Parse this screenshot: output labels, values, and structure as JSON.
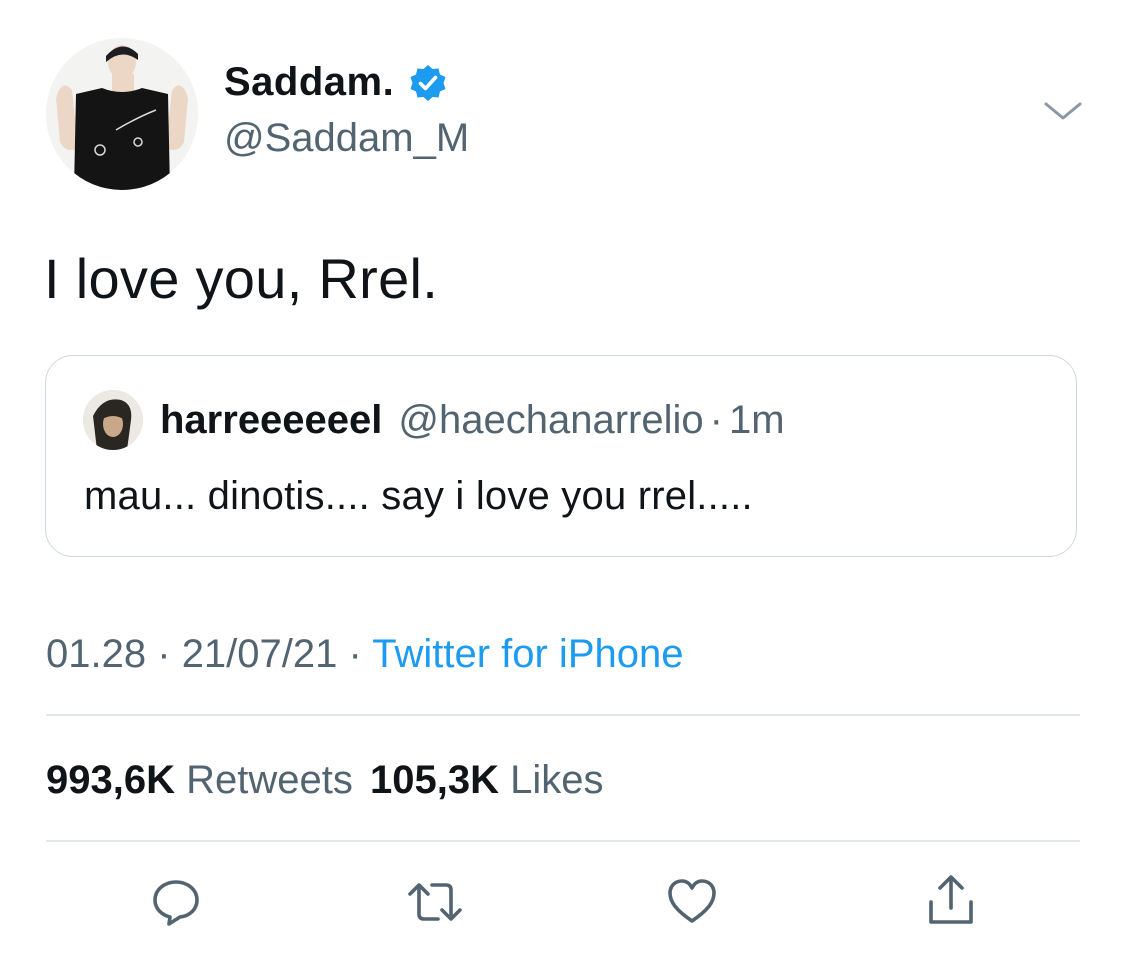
{
  "tweet": {
    "author": {
      "display_name": "Saddam.",
      "handle": "@Saddam_M",
      "verified": true
    },
    "text": "I love you, Rrel.",
    "quoted": {
      "display_name": "harreeeeeel",
      "handle": "@haechanarrelio",
      "separator": "·",
      "time": "1m",
      "text": "mau... dinotis.... say i love you rrel....."
    },
    "meta": {
      "time": "01.28",
      "separator1": "·",
      "date": "21/07/21",
      "separator2": "·",
      "source": "Twitter for iPhone"
    },
    "stats": {
      "retweets_count": "993,6K",
      "retweets_label": "Retweets",
      "likes_count": "105,3K",
      "likes_label": "Likes"
    }
  },
  "icons": {
    "verified": "verified-badge-icon",
    "menu": "chevron-down-icon",
    "reply": "reply-icon",
    "retweet": "retweet-icon",
    "like": "heart-icon",
    "share": "share-icon"
  },
  "colors": {
    "accent": "#1d9bf0",
    "text_primary": "#0f1419",
    "text_secondary": "#536471",
    "border": "#cfd9de"
  }
}
